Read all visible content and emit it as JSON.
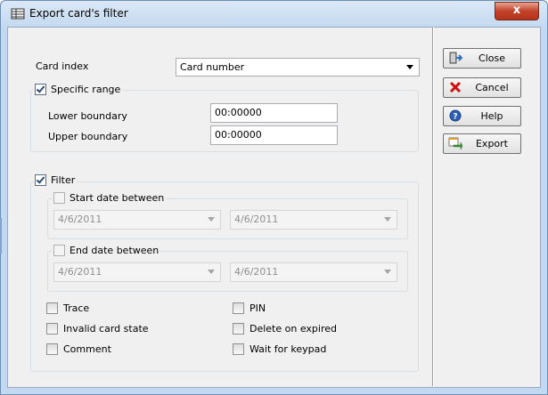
{
  "window": {
    "title": "Export card's filter",
    "close_glyph": "x"
  },
  "card_index": {
    "label": "Card index",
    "value": "Card number"
  },
  "specific_range": {
    "label": "Specific range",
    "checked": true,
    "lower": {
      "label": "Lower boundary",
      "value": "00:00000"
    },
    "upper": {
      "label": "Upper boundary",
      "value": "00:00000"
    }
  },
  "filter": {
    "label": "Filter",
    "checked": true,
    "start_date": {
      "label": "Start date between",
      "checked": false,
      "from": "4/6/2011",
      "to": "4/6/2011"
    },
    "end_date": {
      "label": "End date between",
      "checked": false,
      "from": "4/6/2011",
      "to": "4/6/2011"
    },
    "options_left": [
      {
        "label": "Trace",
        "checked": false
      },
      {
        "label": "Invalid card state",
        "checked": false
      },
      {
        "label": "Comment",
        "checked": false
      }
    ],
    "options_right": [
      {
        "label": "PIN",
        "checked": false
      },
      {
        "label": "Delete on expired",
        "checked": false
      },
      {
        "label": "Wait for keypad",
        "checked": false
      }
    ]
  },
  "buttons": {
    "close": {
      "label": "Close",
      "icon": "exit-door-icon"
    },
    "cancel": {
      "label": "Cancel",
      "icon": "red-x-icon"
    },
    "help": {
      "label": "Help",
      "icon": "help-question-icon"
    },
    "export": {
      "label": "Export",
      "icon": "export-table-icon"
    }
  },
  "colors": {
    "accent": "#3c6fb4",
    "close_red": "#c2422b",
    "cancel_red": "#d01010"
  }
}
